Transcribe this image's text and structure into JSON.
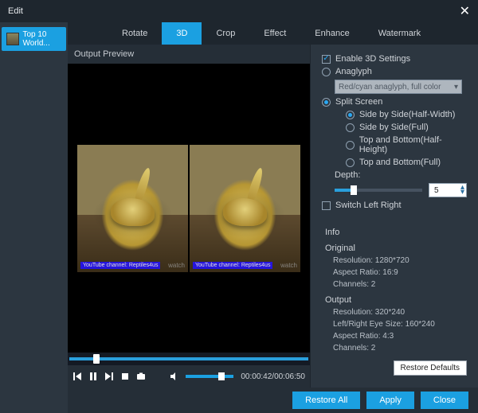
{
  "window": {
    "title": "Edit",
    "close": "✕"
  },
  "sidebar": {
    "items": [
      {
        "label": "Top 10 World..."
      }
    ]
  },
  "tabs": [
    {
      "label": "Rotate"
    },
    {
      "label": "3D",
      "active": true
    },
    {
      "label": "Crop"
    },
    {
      "label": "Effect"
    },
    {
      "label": "Enhance"
    },
    {
      "label": "Watermark"
    }
  ],
  "preview": {
    "label": "Output Preview",
    "time": "00:00:42/00:06:50",
    "overlay_watch": "watch",
    "overlay_yt": "YouTube channel: Reptiles4us"
  },
  "settings": {
    "enable_label": "Enable 3D Settings",
    "anaglyph_label": "Anaglyph",
    "anaglyph_option": "Red/cyan anaglyph, full color",
    "split_label": "Split Screen",
    "split_options": {
      "sbs_half": "Side by Side(Half-Width)",
      "sbs_full": "Side by Side(Full)",
      "tb_half": "Top and Bottom(Half-Height)",
      "tb_full": "Top and Bottom(Full)"
    },
    "depth_label": "Depth:",
    "depth_value": "5",
    "switch_label": "Switch Left Right"
  },
  "info": {
    "heading": "Info",
    "original_heading": "Original",
    "original": {
      "resolution": "Resolution: 1280*720",
      "aspect": "Aspect Ratio: 16:9",
      "channels": "Channels: 2"
    },
    "output_heading": "Output",
    "output": {
      "resolution": "Resolution: 320*240",
      "eye": "Left/Right Eye Size: 160*240",
      "aspect": "Aspect Ratio: 4:3",
      "channels": "Channels: 2"
    }
  },
  "buttons": {
    "restore_defaults": "Restore Defaults",
    "restore_all": "Restore All",
    "apply": "Apply",
    "close": "Close"
  }
}
